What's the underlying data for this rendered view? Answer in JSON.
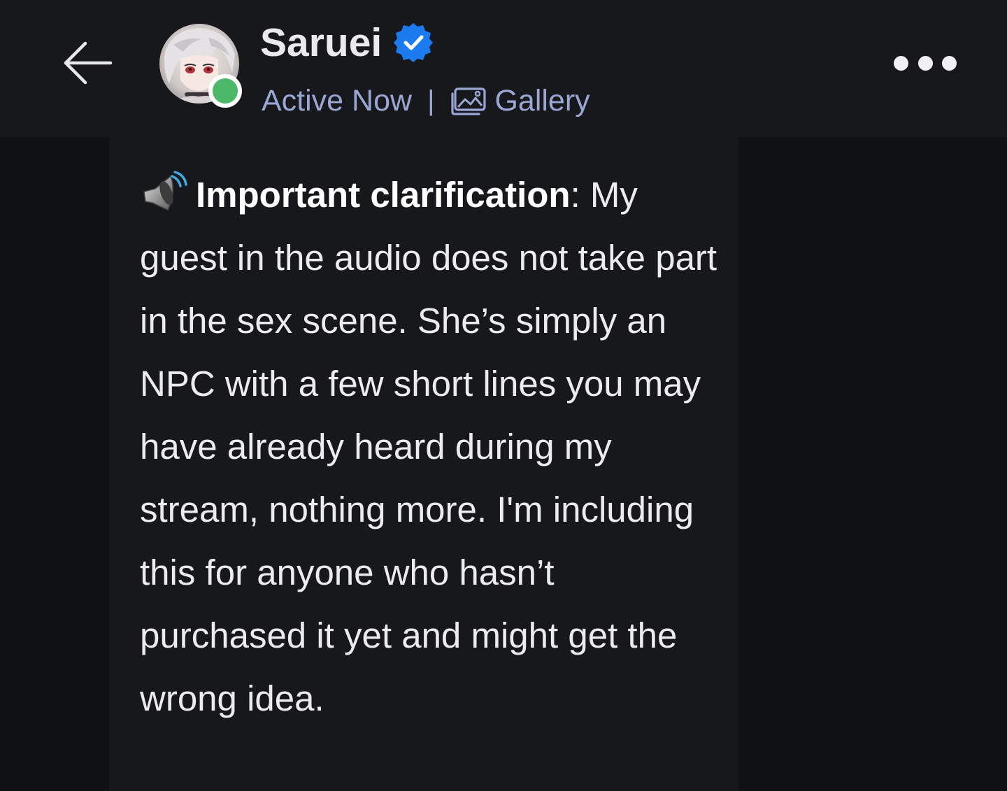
{
  "header": {
    "back_icon": "arrow-left-icon",
    "profile": {
      "name": "Saruei",
      "verified_icon": "verified-badge-icon",
      "status": "Active Now",
      "separator": "|",
      "gallery_label": "Gallery",
      "gallery_icon": "image-gallery-icon",
      "online_indicator_color": "#4cb96a"
    },
    "more_icon": "more-horizontal-icon"
  },
  "message": {
    "icon": "speaker-loud-icon",
    "title": "Important clarification",
    "title_suffix": ":",
    "body": " My guest in the audio does not take part in the sex scene. She’s simply an NPC with a few short lines you may have already heard during my stream, nothing more. I'm including this for anyone who hasn’t purchased it yet and might get the wrong idea."
  },
  "colors": {
    "background": "#101114",
    "surface": "#17181c",
    "text": "#ececf0",
    "muted_accent": "#9aa6d3",
    "verified_blue": "#1d7bf0",
    "online_green": "#4cb96a"
  }
}
